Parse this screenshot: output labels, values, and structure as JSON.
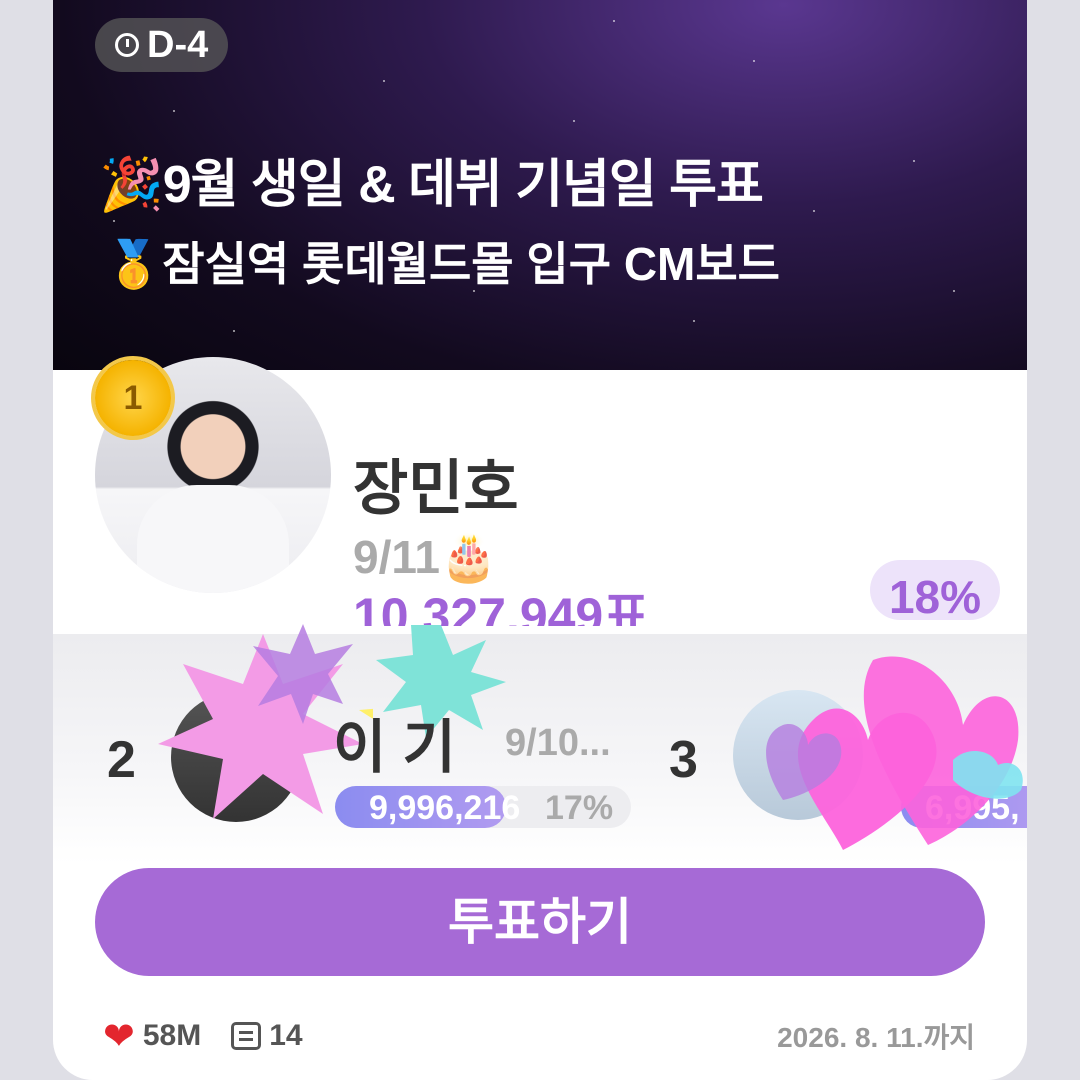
{
  "poll": {
    "dday": "D-4",
    "title_emoji": "🎉",
    "title": "9월 생일 & 데뷔 기념일 투표",
    "subtitle_emoji": "🥇",
    "subtitle": "잠실역 롯데월드몰 입구 CM보드"
  },
  "first": {
    "rank": "1",
    "name": "장민호",
    "birthday": "9/11",
    "birthday_emoji": "🎂",
    "votes": "10,327,949표",
    "percent": "18%"
  },
  "second": {
    "rank": "2",
    "name": "이  기",
    "birthday": "9/10...",
    "votes": "9,996,216",
    "percent": "17%",
    "percent_value": 0.17
  },
  "third": {
    "rank": "3",
    "votes": "6,995,"
  },
  "vote_button": "투표하기",
  "footer": {
    "likes": "58M",
    "comments": "14",
    "deadline": "2026. 8. 11.까지"
  },
  "colors": {
    "accent": "#a66ad6",
    "votes": "#9f62d8",
    "heart": "#e3262e"
  }
}
